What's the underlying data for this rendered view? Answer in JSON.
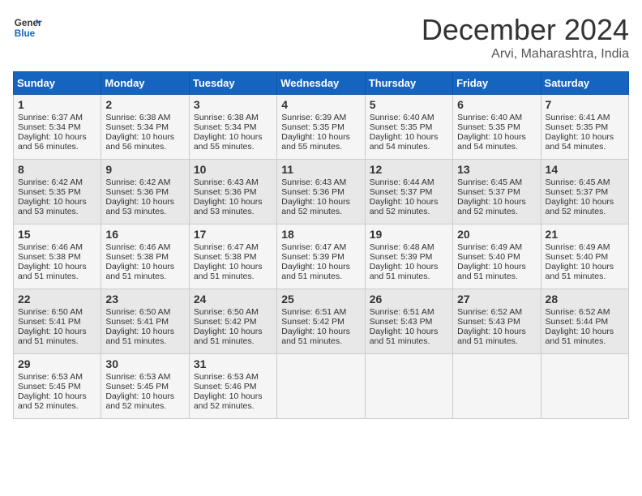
{
  "header": {
    "logo_line1": "General",
    "logo_line2": "Blue",
    "month": "December 2024",
    "location": "Arvi, Maharashtra, India"
  },
  "days_of_week": [
    "Sunday",
    "Monday",
    "Tuesday",
    "Wednesday",
    "Thursday",
    "Friday",
    "Saturday"
  ],
  "weeks": [
    [
      {
        "day": "1",
        "info": "Sunrise: 6:37 AM\nSunset: 5:34 PM\nDaylight: 10 hours\nand 56 minutes."
      },
      {
        "day": "2",
        "info": "Sunrise: 6:38 AM\nSunset: 5:34 PM\nDaylight: 10 hours\nand 56 minutes."
      },
      {
        "day": "3",
        "info": "Sunrise: 6:38 AM\nSunset: 5:34 PM\nDaylight: 10 hours\nand 55 minutes."
      },
      {
        "day": "4",
        "info": "Sunrise: 6:39 AM\nSunset: 5:35 PM\nDaylight: 10 hours\nand 55 minutes."
      },
      {
        "day": "5",
        "info": "Sunrise: 6:40 AM\nSunset: 5:35 PM\nDaylight: 10 hours\nand 54 minutes."
      },
      {
        "day": "6",
        "info": "Sunrise: 6:40 AM\nSunset: 5:35 PM\nDaylight: 10 hours\nand 54 minutes."
      },
      {
        "day": "7",
        "info": "Sunrise: 6:41 AM\nSunset: 5:35 PM\nDaylight: 10 hours\nand 54 minutes."
      }
    ],
    [
      {
        "day": "8",
        "info": "Sunrise: 6:42 AM\nSunset: 5:35 PM\nDaylight: 10 hours\nand 53 minutes."
      },
      {
        "day": "9",
        "info": "Sunrise: 6:42 AM\nSunset: 5:36 PM\nDaylight: 10 hours\nand 53 minutes."
      },
      {
        "day": "10",
        "info": "Sunrise: 6:43 AM\nSunset: 5:36 PM\nDaylight: 10 hours\nand 53 minutes."
      },
      {
        "day": "11",
        "info": "Sunrise: 6:43 AM\nSunset: 5:36 PM\nDaylight: 10 hours\nand 52 minutes."
      },
      {
        "day": "12",
        "info": "Sunrise: 6:44 AM\nSunset: 5:37 PM\nDaylight: 10 hours\nand 52 minutes."
      },
      {
        "day": "13",
        "info": "Sunrise: 6:45 AM\nSunset: 5:37 PM\nDaylight: 10 hours\nand 52 minutes."
      },
      {
        "day": "14",
        "info": "Sunrise: 6:45 AM\nSunset: 5:37 PM\nDaylight: 10 hours\nand 52 minutes."
      }
    ],
    [
      {
        "day": "15",
        "info": "Sunrise: 6:46 AM\nSunset: 5:38 PM\nDaylight: 10 hours\nand 51 minutes."
      },
      {
        "day": "16",
        "info": "Sunrise: 6:46 AM\nSunset: 5:38 PM\nDaylight: 10 hours\nand 51 minutes."
      },
      {
        "day": "17",
        "info": "Sunrise: 6:47 AM\nSunset: 5:38 PM\nDaylight: 10 hours\nand 51 minutes."
      },
      {
        "day": "18",
        "info": "Sunrise: 6:47 AM\nSunset: 5:39 PM\nDaylight: 10 hours\nand 51 minutes."
      },
      {
        "day": "19",
        "info": "Sunrise: 6:48 AM\nSunset: 5:39 PM\nDaylight: 10 hours\nand 51 minutes."
      },
      {
        "day": "20",
        "info": "Sunrise: 6:49 AM\nSunset: 5:40 PM\nDaylight: 10 hours\nand 51 minutes."
      },
      {
        "day": "21",
        "info": "Sunrise: 6:49 AM\nSunset: 5:40 PM\nDaylight: 10 hours\nand 51 minutes."
      }
    ],
    [
      {
        "day": "22",
        "info": "Sunrise: 6:50 AM\nSunset: 5:41 PM\nDaylight: 10 hours\nand 51 minutes."
      },
      {
        "day": "23",
        "info": "Sunrise: 6:50 AM\nSunset: 5:41 PM\nDaylight: 10 hours\nand 51 minutes."
      },
      {
        "day": "24",
        "info": "Sunrise: 6:50 AM\nSunset: 5:42 PM\nDaylight: 10 hours\nand 51 minutes."
      },
      {
        "day": "25",
        "info": "Sunrise: 6:51 AM\nSunset: 5:42 PM\nDaylight: 10 hours\nand 51 minutes."
      },
      {
        "day": "26",
        "info": "Sunrise: 6:51 AM\nSunset: 5:43 PM\nDaylight: 10 hours\nand 51 minutes."
      },
      {
        "day": "27",
        "info": "Sunrise: 6:52 AM\nSunset: 5:43 PM\nDaylight: 10 hours\nand 51 minutes."
      },
      {
        "day": "28",
        "info": "Sunrise: 6:52 AM\nSunset: 5:44 PM\nDaylight: 10 hours\nand 51 minutes."
      }
    ],
    [
      {
        "day": "29",
        "info": "Sunrise: 6:53 AM\nSunset: 5:45 PM\nDaylight: 10 hours\nand 52 minutes."
      },
      {
        "day": "30",
        "info": "Sunrise: 6:53 AM\nSunset: 5:45 PM\nDaylight: 10 hours\nand 52 minutes."
      },
      {
        "day": "31",
        "info": "Sunrise: 6:53 AM\nSunset: 5:46 PM\nDaylight: 10 hours\nand 52 minutes."
      },
      {
        "day": "",
        "info": ""
      },
      {
        "day": "",
        "info": ""
      },
      {
        "day": "",
        "info": ""
      },
      {
        "day": "",
        "info": ""
      }
    ]
  ]
}
